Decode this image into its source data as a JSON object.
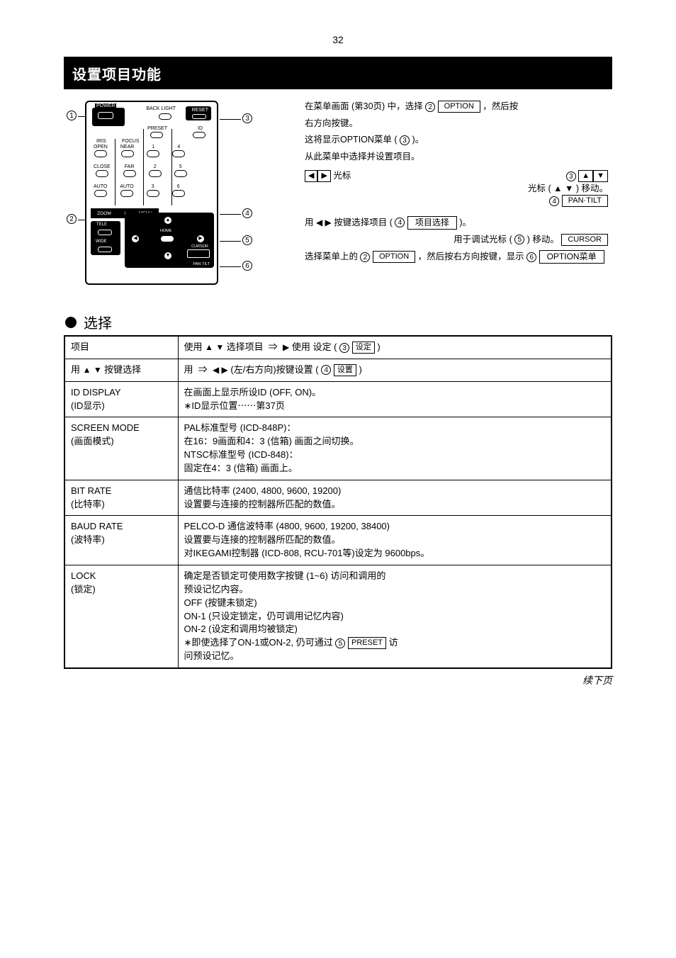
{
  "page_number_top": "32",
  "title": "设置项目功能",
  "options_intro": {
    "line1_before": "在菜单画面 (第30页) 中，选择 ",
    "line1_circle": "2",
    "line1_boxed": "OPTION",
    "line1_after": "，然后按",
    "line2": "右方向按键。",
    "line3_before": "这将显示OPTION菜单 (",
    "line3_circle": "3",
    "line3_after": ")。",
    "line4": "从此菜单中选择并设置项目。"
  },
  "cursor_movement": {
    "left": "光标",
    "right_before": "光标 (",
    "right_updown": "▲ ▼",
    "right_after": ") 移动。",
    "right_label": "PAN·TILT"
  },
  "item_selection": {
    "l1_a": "用 ",
    "l1_b": " 按键选择项目 (",
    "l1_circle": "4",
    "l1_boxed": "项目选择",
    "l1_c": ")。",
    "l2_a": "用于调试光标 (",
    "l2_b": ") 移动。",
    "l2_circle": "5",
    "l2_boxed": "CURSOR"
  },
  "option_line": {
    "l1_a": "选择菜单上的 ",
    "l1_circle_a": "2",
    "l1_boxed_a": "OPTION",
    "l1_b": "，然后按右方向按键，显示 ",
    "l1_circle_b": "6",
    "l1_boxed_b": "OPTION菜单"
  },
  "table": {
    "header": {
      "col1": "项目",
      "col2_a": "使用",
      "col2_b": "选择项目",
      "col2_c": "使用",
      "col2_d": "设定 (",
      "col2_circle": "3",
      "col2_boxed": "设定",
      "col2_e": ")"
    },
    "sub_header": {
      "col1_a": "用",
      "col1_b": "按键选择",
      "col2_a": "用 ",
      "col2_b": " (左/右方向)按键设置 (",
      "col2_circle": "4",
      "col2_boxed": "设置",
      "col2_c": ")"
    },
    "rows": [
      {
        "name": "ID DISPLAY\n(ID显示)",
        "desc": "在画面上显示所设ID (OFF, ON)。\n∗ID显示位置⋯⋯第37页"
      },
      {
        "name": "SCREEN MODE\n(画面模式)",
        "desc": "PAL标准型号 (ICD-848P)：\n在16：9画面和4：3 (信箱) 画面之间切换。\nNTSC标准型号 (ICD-848)：\n固定在4：3 (信箱) 画面上。"
      },
      {
        "name": "BIT RATE\n(比特率)",
        "desc": "通信比特率 (2400, 4800, 9600, 19200)\n设置要与连接的控制器所匹配的数值。"
      },
      {
        "name": "BAUD RATE\n(波特率)",
        "desc": "PELCO-D 通信波特率 (4800, 9600, 19200, 38400)\n设置要与连接的控制器所匹配的数值。\n对IKEGAMI控制器 (ICD-808, RCU-701等)设定为 9600bps。"
      },
      {
        "name": "LOCK\n(锁定)",
        "desc": "确定是否锁定可使用数字按键 (1~6) 访问和调用的\n预设记忆内容。\nOFF (按键未锁定)\nON-1 (只设定锁定，仍可调用记忆内容)\nON-2 (设定和调用均被锁定)\n∗即使选择了ON-1或ON-2, 仍可通过 ",
        "desc_circle": "5",
        "desc_boxed": "PRESET",
        "desc_after": " 访\n问预设记忆。"
      }
    ]
  },
  "subtitle": "选择",
  "continued": "续下页",
  "callouts": {
    "c1": "1",
    "c2": "2",
    "c3": "3",
    "c4": "4",
    "c5": "5"
  },
  "remote": {
    "power": "POWER",
    "backlight": "BACK LIGHT",
    "reset": "RESET",
    "preset": "PRESET",
    "id": "ID",
    "iris": "IRIS",
    "focus": "FOCUS",
    "open": "OPEN",
    "near": "NEAR",
    "close": "CLOSE",
    "far": "FAR",
    "auto": "AUTO",
    "zoom": "ZOOM",
    "menu": "MENU",
    "tele": "TELE",
    "wide": "WIDE",
    "home": "HOME",
    "cursor": "CURSOR",
    "pantilt": "PAN·TILT"
  }
}
